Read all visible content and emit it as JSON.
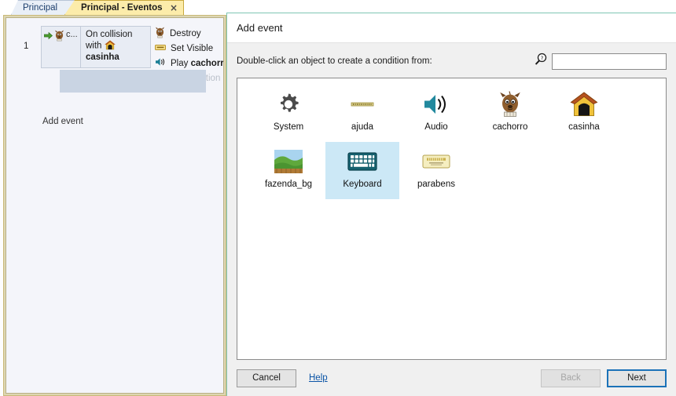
{
  "tabs": [
    {
      "label": "Principal",
      "active": false,
      "closable": false
    },
    {
      "label": "Principal - Eventos",
      "active": true,
      "closable": true,
      "close_glyph": "×"
    }
  ],
  "event_sheet": {
    "event_number": "1",
    "condition": {
      "object_icon": "dog-icon",
      "arrow_icon": "green-arrow-icon",
      "object_label": "c...",
      "text_prefix": "On collision",
      "text_line2": "with",
      "inline_icon": "casinha-house-icon",
      "target_object": "casinha"
    },
    "actions": [
      {
        "icon": "dog-icon",
        "label": "Destroy",
        "bold_suffix": ""
      },
      {
        "icon": "set-visible-icon",
        "label": "Set Visible",
        "bold_suffix": ""
      },
      {
        "icon": "audio-speaker-icon",
        "label": "Play ",
        "bold_suffix": "cachorro"
      }
    ],
    "add_action_label": "Add action",
    "add_event_label": "Add event"
  },
  "dialog": {
    "title": "Add event",
    "prompt": "Double-click an object to create a condition from:",
    "search": {
      "value": "",
      "placeholder": "",
      "icon": "search-help-icon"
    },
    "objects": [
      {
        "label": "System",
        "icon": "gear-icon",
        "selected": false
      },
      {
        "label": "ajuda",
        "icon": "ajuda-bar-icon",
        "selected": false
      },
      {
        "label": "Audio",
        "icon": "speaker-icon",
        "selected": false
      },
      {
        "label": "cachorro",
        "icon": "dog-icon",
        "selected": false
      },
      {
        "label": "casinha",
        "icon": "house-icon",
        "selected": false
      },
      {
        "label": "fazenda_bg",
        "icon": "field-bg-icon",
        "selected": false
      },
      {
        "label": "Keyboard",
        "icon": "keyboard-icon",
        "selected": true
      },
      {
        "label": "parabens",
        "icon": "card-icon",
        "selected": false
      }
    ],
    "buttons": {
      "cancel": "Cancel",
      "help": "Help",
      "back": "Back",
      "next": "Next"
    }
  },
  "colors": {
    "tab_active_bg": "#fcecaa",
    "tab_inactive_bg": "#e9eff7",
    "dialog_border": "#7fc6b4",
    "selection_bg": "#cce8f6",
    "next_focus_border": "#1b72b8",
    "link": "#0b54a6",
    "sheet_frame": "#c9b978"
  }
}
